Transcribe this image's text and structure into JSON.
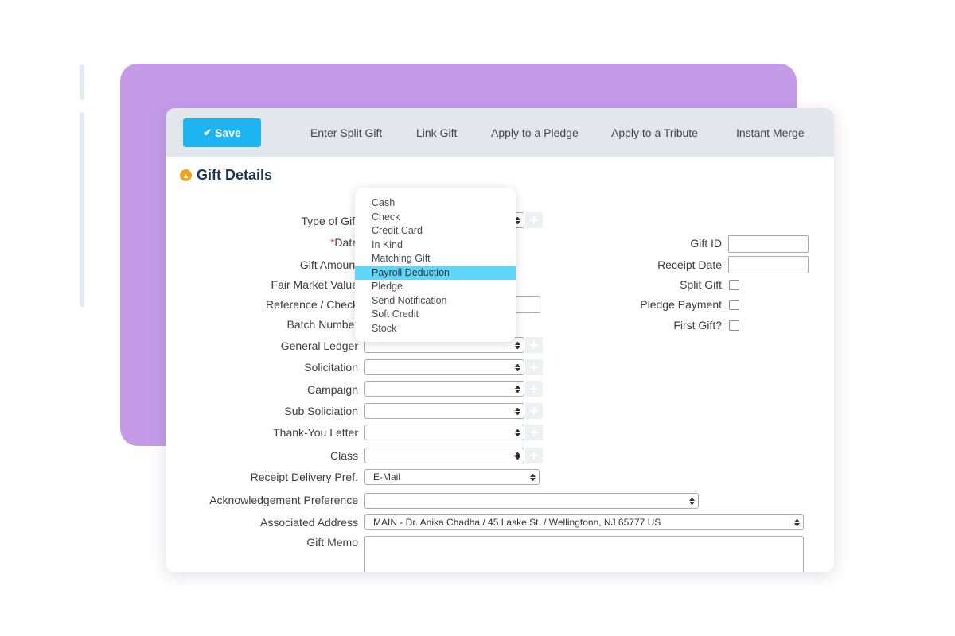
{
  "toolbar": {
    "save_label": "Save",
    "links": [
      "Enter Split Gift",
      "Link Gift",
      "Apply to a Pledge",
      "Apply to a Tribute",
      "Instant Merge"
    ]
  },
  "section": {
    "title": "Gift Details"
  },
  "form_left": {
    "type_of_gift": "Type of Gift",
    "date_required_mark": "*",
    "date": "Date",
    "gift_amount": "Gift Amount",
    "fair_market_value": "Fair Market Value",
    "reference_check": "Reference / Check",
    "batch_number": "Batch Number",
    "general_ledger": "General Ledger",
    "solicitation": "Solicitation",
    "campaign": "Campaign",
    "sub_soliciation": "Sub Soliciation",
    "thank_you_letter": "Thank-You Letter",
    "class": "Class",
    "receipt_delivery_pref": "Receipt Delivery Pref.",
    "receipt_delivery_value": "E-Mail",
    "acknowledgement_preference": "Acknowledgement Preference",
    "acknowledgement_value": "",
    "associated_address": "Associated Address",
    "associated_address_value": "MAIN - Dr. Anika Chadha / 45 Laske St. / Wellingtonn, NJ 65777 US",
    "gift_memo": "Gift Memo"
  },
  "form_right": {
    "gift_id": "Gift ID",
    "receipt_date": "Receipt Date",
    "split_gift": "Split Gift",
    "pledge_payment": "Pledge Payment",
    "first_gift": "First Gift?"
  },
  "dropdown": {
    "options": [
      "Cash",
      "Check",
      "Credit Card",
      "In Kind",
      "Matching Gift",
      "Payroll Deduction",
      "Pledge",
      "Send Notification",
      "Soft Credit",
      "Stock"
    ],
    "highlighted": "Payroll Deduction"
  },
  "colors": {
    "accent_purple": "#c59be9",
    "save_button": "#1cb5f2",
    "highlight": "#5fd7fb",
    "section_icon": "#f0a41c",
    "section_title": "#1c3654"
  }
}
